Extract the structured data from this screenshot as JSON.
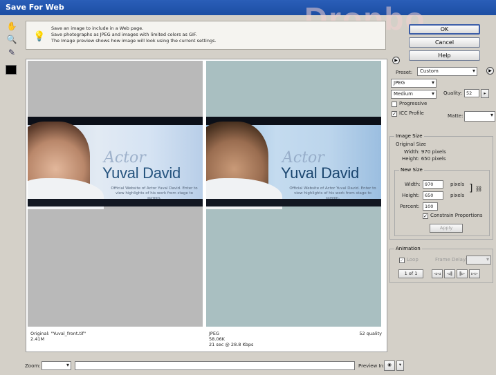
{
  "window": {
    "title": "Save For Web"
  },
  "watermark": "Dropbo",
  "info": {
    "lines": [
      "Save an image to include in a Web page.",
      "Save photographs as JPEG and images with limited colors as GIF.",
      "The Image preview shows how image will look using the current settings."
    ]
  },
  "preview": {
    "banner": {
      "actor_text": "Actor",
      "name_text": "Yuval David",
      "tagline": "Official Website of Actor Yuval David. Enter to view highlights of his work from stage to screen."
    },
    "left_caption": {
      "line1": "Original: \"Yuval_front.tif\"",
      "line2": "2.41M"
    },
    "right_caption": {
      "line1": "JPEG",
      "line2": "58.06K",
      "line3": "21 sec @ 28.8 Kbps",
      "quality": "52 quality"
    }
  },
  "buttons": {
    "ok": "OK",
    "cancel": "Cancel",
    "help": "Help"
  },
  "settings": {
    "preset_label": "Preset:",
    "preset_value": "Custom",
    "format_value": "JPEG",
    "compression_value": "Medium",
    "quality_label": "Quality:",
    "quality_value": "52",
    "progressive_label": "Progressive",
    "progressive_checked": false,
    "icc_label": "ICC Profile",
    "icc_checked": true,
    "matte_label": "Matte:"
  },
  "image_size": {
    "title": "Image Size",
    "original_title": "Original Size",
    "orig_width": "Width: 970 pixels",
    "orig_height": "Height: 650 pixels",
    "new_title": "New Size",
    "width_label": "Width:",
    "width_value": "970",
    "height_label": "Height:",
    "height_value": "650",
    "percent_label": "Percent:",
    "percent_value": "100",
    "unit": "pixels",
    "constrain_label": "Constrain Proportions",
    "constrain_checked": true,
    "apply_label": "Apply"
  },
  "animation": {
    "title": "Animation",
    "loop_label": "Loop",
    "frame_delay_label": "Frame Delay:",
    "frame_counter": "1 of 1"
  },
  "bottom": {
    "zoom_label": "Zoom:",
    "preview_label": "Preview In:"
  }
}
